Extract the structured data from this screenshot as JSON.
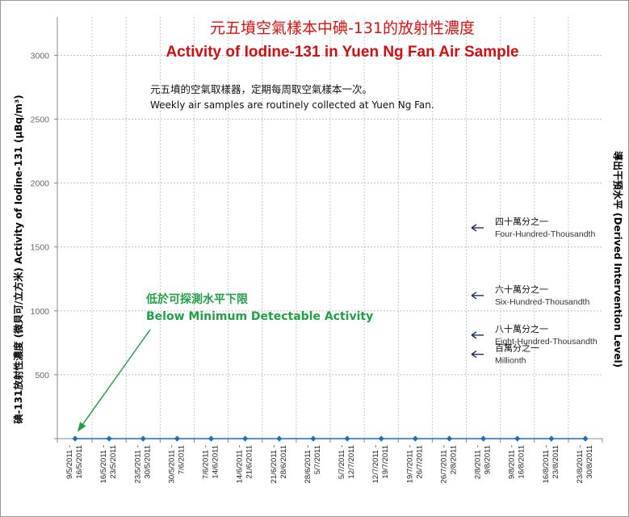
{
  "chart_data": {
    "type": "line",
    "title_zh": "元五墳空氣樣本中碘-131的放射性濃度",
    "title_en": "Activity of Iodine-131 in Yuen Ng Fan Air Sample",
    "note_zh": "元五墳的空氣取樣器，定期每周取空氣樣本一次。",
    "note_en": "Weekly air samples are routinely collected at Yuen Ng Fan.",
    "ylabel": "碘-131放射性濃度 (微貝可/立方米)  Activity of Iodine-131 (µBq/m³)",
    "y2label": "導出干預水平 (Derived Intervention Level)",
    "ylim": [
      0,
      3300
    ],
    "yticks": [
      500,
      1000,
      1500,
      2000,
      2500,
      3000
    ],
    "grid": true,
    "legend": "none",
    "categories": [
      [
        "9/5/2011 -",
        "16/5/2011"
      ],
      [
        "16/5/2011 -",
        "23/5/2011"
      ],
      [
        "23/5/2011 -",
        "30/5/2011"
      ],
      [
        "30/5/2011 -",
        "7/6/2011"
      ],
      [
        "7/6/2011 -",
        "14/6/2011"
      ],
      [
        "14/6/2011 -",
        "21/6/2011"
      ],
      [
        "21/6/2011 -",
        "28/6/2011"
      ],
      [
        "28/6/2011 -",
        "5/7/2011"
      ],
      [
        "5/7/2011 -",
        "12/7/2011"
      ],
      [
        "12/7/2011 -",
        "19/7/2011"
      ],
      [
        "19/7/2011 -",
        "26/7/2011"
      ],
      [
        "26/7/2011 -",
        "2/8/2011"
      ],
      [
        "2/8/2011 -",
        "9/8/2011"
      ],
      [
        "9/8/2011 -",
        "16/8/2011"
      ],
      [
        "16/8/2011 -",
        "23/8/2011"
      ],
      [
        "23/8/2011 -",
        "30/8/2011"
      ]
    ],
    "series": [
      {
        "values": [
          0,
          0,
          0,
          0,
          0,
          0,
          0,
          0,
          0,
          0,
          0,
          0,
          0,
          0,
          0,
          0
        ],
        "color": "#1f6fb5"
      }
    ],
    "annotations": {
      "mda": {
        "zh": "低於可探測水平下限",
        "en": "Below Minimum Detectable Activity",
        "color": "#22a045"
      },
      "dil": [
        {
          "zh": "四十萬分之一",
          "en": "Four-Hundred-Thousandth",
          "y": 1650
        },
        {
          "zh": "六十萬分之一",
          "en": "Six-Hundred-Thousandth",
          "y": 1120
        },
        {
          "zh": "八十萬分之一",
          "en": "Eight-Hundred-Thousandth",
          "y": 810
        },
        {
          "zh": "百萬分之一",
          "en": "Millionth",
          "y": 660
        }
      ]
    }
  }
}
